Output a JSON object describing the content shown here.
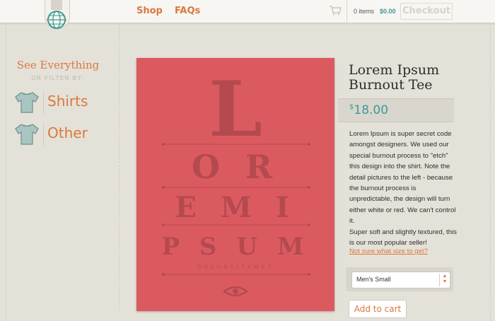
{
  "header": {
    "nav": [
      "Shop",
      "FAQs"
    ],
    "cart_items": "0 items",
    "cart_total": "$0.00",
    "checkout_label": "Checkout"
  },
  "sidebar": {
    "heading": "See Everything",
    "filter_label": "OR FILTER BY:",
    "categories": [
      {
        "label": "Shirts",
        "icon": "tshirt-icon"
      },
      {
        "label": "Other",
        "icon": "tshirt-icon"
      }
    ]
  },
  "product": {
    "title": "Lorem Ipsum Burnout Tee",
    "price_currency": "$",
    "price_amount": "18.00",
    "description": [
      "Lorem Ipsum is super secret code amongst designers. We used our special burnout process to \"etch\" this design into the shirt. Note the detail pictures to the left - because the burnout process is unpredictable, the design will turn either white or red. We can't control it.",
      "Super soft and slightly textured, this is our most popular seller!"
    ],
    "size_help_link": "Not sure what size to get?",
    "size_selected": "Men's Small",
    "add_to_cart_label": "Add to cart",
    "image": {
      "lines": [
        "L",
        "O R",
        "E M I",
        "P S U M"
      ],
      "small_text": "DOLORSITAMET",
      "shirt_color": "#db5a60",
      "print_color": "#b44a50"
    }
  },
  "colors": {
    "accent_orange": "#d9793d",
    "teal": "#3d9a95",
    "background": "#e4e1d8"
  }
}
